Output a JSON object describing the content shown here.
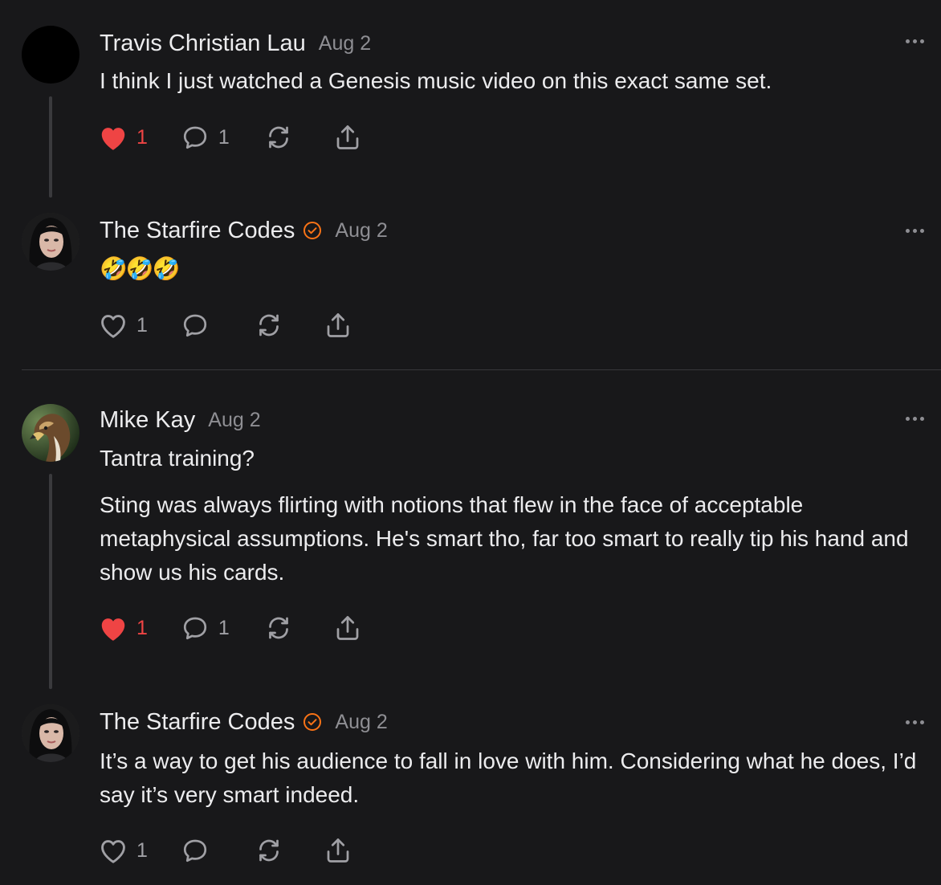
{
  "comments": [
    {
      "author": "Travis Christian Lau",
      "date": "Aug 2",
      "verified": false,
      "paragraphs": [
        "I think I just watched a Genesis music video on this exact same set."
      ],
      "likes": "1",
      "liked": true,
      "replies": "1"
    },
    {
      "author": "The Starfire Codes",
      "date": "Aug 2",
      "verified": true,
      "paragraphs": [
        "🤣🤣🤣"
      ],
      "likes": "1",
      "liked": false,
      "replies": ""
    },
    {
      "author": "Mike Kay",
      "date": "Aug 2",
      "verified": false,
      "paragraphs": [
        "Tantra training?",
        "Sting was always flirting with notions that flew in the face of acceptable metaphysical assumptions. He's smart tho, far too smart to really tip his hand and show us his cards."
      ],
      "likes": "1",
      "liked": true,
      "replies": "1"
    },
    {
      "author": "The Starfire Codes",
      "date": "Aug 2",
      "verified": true,
      "paragraphs": [
        "It’s a way to get his audience to fall in love with him. Considering what he does, I’d say it’s very smart indeed."
      ],
      "likes": "1",
      "liked": false,
      "replies": ""
    }
  ],
  "icons": {
    "like": "heart-icon",
    "reply": "speech-bubble-icon",
    "restack": "restack-arrows-icon",
    "share": "share-upload-icon",
    "more": "more-horizontal-icon",
    "verified": "verified-check-badge-icon"
  },
  "colors": {
    "background": "#18181a",
    "liked": "#ef4444",
    "verified": "#f97316",
    "muted": "#8e8e93"
  }
}
